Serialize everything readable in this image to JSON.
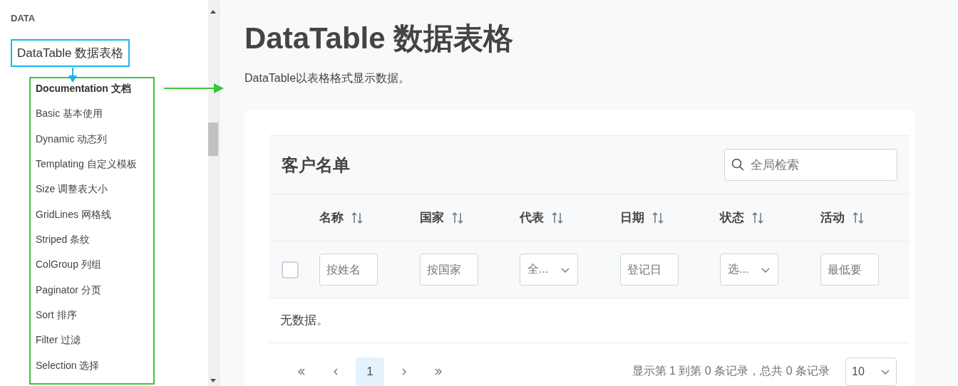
{
  "sidebar": {
    "section": "DATA",
    "parent_item": "DataTable 数据表格",
    "items": [
      {
        "label": "Documentation 文档",
        "selected": true
      },
      {
        "label": "Basic 基本使用",
        "selected": false
      },
      {
        "label": "Dynamic 动态列",
        "selected": false
      },
      {
        "label": "Templating 自定义模板",
        "selected": false
      },
      {
        "label": "Size 调整表大小",
        "selected": false
      },
      {
        "label": "GridLines 网格线",
        "selected": false
      },
      {
        "label": "Striped 条纹",
        "selected": false
      },
      {
        "label": "ColGroup 列组",
        "selected": false
      },
      {
        "label": "Paginator 分页",
        "selected": false
      },
      {
        "label": "Sort 排序",
        "selected": false
      },
      {
        "label": "Filter 过滤",
        "selected": false
      },
      {
        "label": "Selection 选择",
        "selected": false
      }
    ]
  },
  "main": {
    "title": "DataTable 数据表格",
    "description": "DataTable以表格格式显示数据。",
    "table": {
      "title": "客户名单",
      "search_placeholder": "全局检索",
      "select_all_checked": false,
      "columns": [
        {
          "label": "名称",
          "filter": {
            "kind": "text",
            "placeholder": "按姓名"
          }
        },
        {
          "label": "国家",
          "filter": {
            "kind": "text",
            "placeholder": "按国家"
          }
        },
        {
          "label": "代表",
          "filter": {
            "kind": "dropdown",
            "placeholder": "全..."
          }
        },
        {
          "label": "日期",
          "filter": {
            "kind": "text",
            "placeholder": "登记日"
          }
        },
        {
          "label": "状态",
          "filter": {
            "kind": "dropdown",
            "placeholder": "选..."
          }
        },
        {
          "label": "活动",
          "filter": {
            "kind": "text",
            "placeholder": "最低要"
          }
        }
      ],
      "empty_message": "无数据。",
      "paginator": {
        "pages": [
          {
            "label": "1",
            "selected": true
          }
        ],
        "summary": "显示第 1 到第 0 条记录，总共 0 条记录",
        "rows_per_page": "10"
      }
    }
  }
}
